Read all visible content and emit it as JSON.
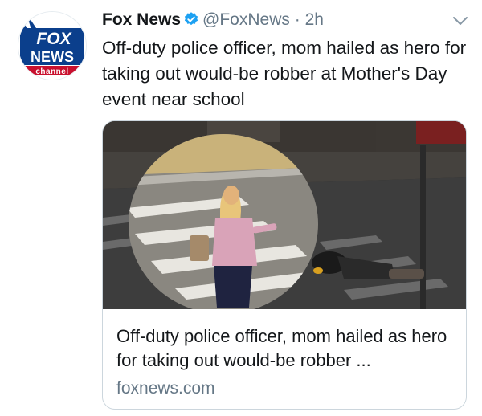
{
  "tweet": {
    "author": {
      "name": "Fox News",
      "handle": "@FoxNews",
      "separator": "·",
      "time": "2h",
      "verified": true,
      "avatar_logo": {
        "line1": "FOX",
        "line2": "NEWS",
        "line3": "channel"
      }
    },
    "text": "Off-duty police officer, mom hailed as hero for taking out would-be robber at Mother's Day event near school",
    "menu_icon": "chevron-down-icon"
  },
  "card": {
    "image_icon": "street-scene-photo",
    "title": "Off-duty police officer, mom hailed as hero for taking out would-be robber ...",
    "domain": "foxnews.com"
  },
  "colors": {
    "verified_badge": "#1da1f2",
    "secondary_text": "#657786",
    "card_border": "#ccd6dd",
    "fox_blue": "#0b3f8c",
    "fox_red": "#c8102e"
  }
}
